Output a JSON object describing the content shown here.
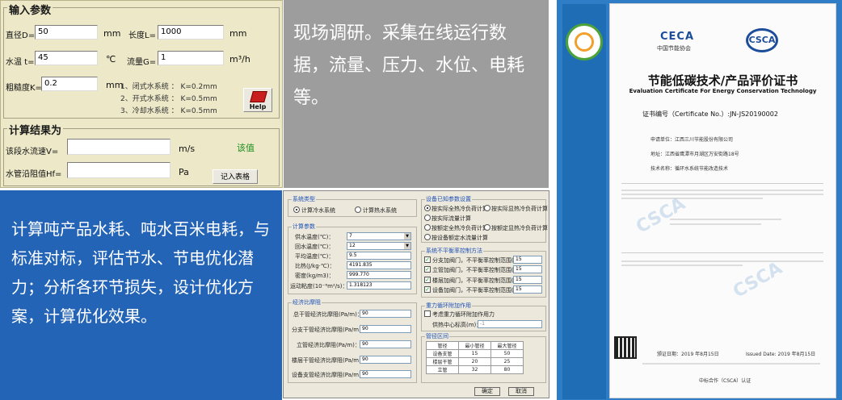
{
  "calc": {
    "input_group_title": "输入参数",
    "diameter_label": "直径D=",
    "diameter_value": "50",
    "diameter_unit": "mm",
    "length_label": "长度L=",
    "length_value": "1000",
    "length_unit": "mm",
    "temp_label": "水温 t=",
    "temp_value": "45",
    "temp_unit": "℃",
    "flow_label": "流量G=",
    "flow_value": "1",
    "flow_unit": "m³/h",
    "rough_label": "粗糙度K=",
    "rough_value": "0.2",
    "rough_unit": "mm",
    "note1": "1、闭式水系统 ： K=0.2mm",
    "note2": "2、开式水系统 ： K=0.5mm",
    "note3": "3、冷却水系统 ： K=0.5mm",
    "help_label": "Help",
    "result_group_title": "计算结果为",
    "velocity_label": "该段水流速V=",
    "velocity_unit": "m/s",
    "velocity_note": "该值",
    "resistance_label": "水管沿阻值Hf=",
    "resistance_unit": "Pa",
    "record_button": "记入表格"
  },
  "gray_block": {
    "text": "现场调研。采集在线运行数据，流量、压力、水位、电耗等。"
  },
  "blue_block": {
    "text": "计算吨产品水耗、吨水百米电耗，与标准对标，评估节水、节电优化潜力；分析各环节损失，设计优化方案，计算优化效果。"
  },
  "software": {
    "sys_type_title": "系统类型",
    "radio_cold": "计算冷水系统",
    "radio_hot": "计算热水系统",
    "calc_params_title": "计算参数",
    "supply_temp_label": "供水温度(℃)：",
    "supply_temp_value": "7",
    "return_temp_label": "回水温度(℃)：",
    "return_temp_value": "12",
    "avg_temp_label": "平均温度(℃)：",
    "avg_temp_value": "9.5",
    "specific_heat_label": "比热(J/kg·℃)：",
    "specific_heat_value": "4191.835",
    "density_label": "密度(kg/m3)：",
    "density_value": "999.770",
    "viscosity_label": "运动粘度(10⁻⁶m²/s)：",
    "viscosity_value": "1.318123",
    "friction_title": "经济比摩阻",
    "main_pipe_label": "总干管经济比摩阻(Pa/m)：",
    "main_pipe_value": "90",
    "branch_main_label": "分支干管经济比摩阻(Pa/m)：",
    "branch_main_value": "90",
    "riser_label": "立管经济比摩阻(Pa/m)：",
    "riser_value": "90",
    "floor_main_label": "楼层干管经济比摩阻(Pa/m)：",
    "floor_main_value": "90",
    "equip_label": "设备支管经济比摩阻(Pa/m)：",
    "equip_value": "90",
    "equip_setting_title": "设备已知参数设置",
    "opt1": "按实际全热冷负荷计算",
    "opt2": "按实际显热冷负荷计算",
    "opt3": "按实际流量计算",
    "opt4": "按额定全热冷负荷计算",
    "opt5": "按额定显热冷负荷计算",
    "opt6": "按设备额定水流量计算",
    "unbalance_title": "系统不平衡率控制方法",
    "ub1": "分支加阀门，不平衡率控制范围(%)：",
    "ub1_value": "15",
    "ub2": "立管加阀门，不平衡率控制范围(%)：",
    "ub2_value": "15",
    "ub3": "楼层加阀门，不平衡率控制范围(%)：",
    "ub3_value": "15",
    "ub4": "设备加阀门，不平衡率控制范围(%)：",
    "ub4_value": "15",
    "gravity_title": "重力循环附加作用",
    "gravity_check": "考虑重力循环附加作用力",
    "gravity_height_label": "供热中心标高(m)：",
    "gravity_height_value": "-1",
    "pipe_zone_title": "管径区间",
    "pipe_table_headers": [
      "管径",
      "最小管径",
      "最大管径"
    ],
    "pipe_table_rows": [
      [
        "设备支管",
        "15",
        "50"
      ],
      [
        "楼层干管",
        "20",
        "25"
      ],
      [
        "立管",
        "32",
        "80"
      ]
    ],
    "ok_button": "确定",
    "cancel_button": "取消"
  },
  "certificate": {
    "ceca_logo": "CECA",
    "ceca_sub": "中国节能协会",
    "csca_logo": "CSCA",
    "title": "节能低碳技术/产品评价证书",
    "subtitle": "Evaluation Certificate For Energy Conservation Technology",
    "cert_no": "证书编号（Certificate No.）:JN-JS20190002",
    "applicant": "申请单位：江西三川节能股份有限公司",
    "address": "地址：江西省鹰潭市月湖区万安街路18号",
    "tech_name": "技术名称：循环水系统节能改造技术",
    "issue_date_label": "颁证日期：2019 年8月15日",
    "issued_label": "Issued Date: 2019 年8月15日",
    "footer": "中标合作（CSCA）认证"
  }
}
